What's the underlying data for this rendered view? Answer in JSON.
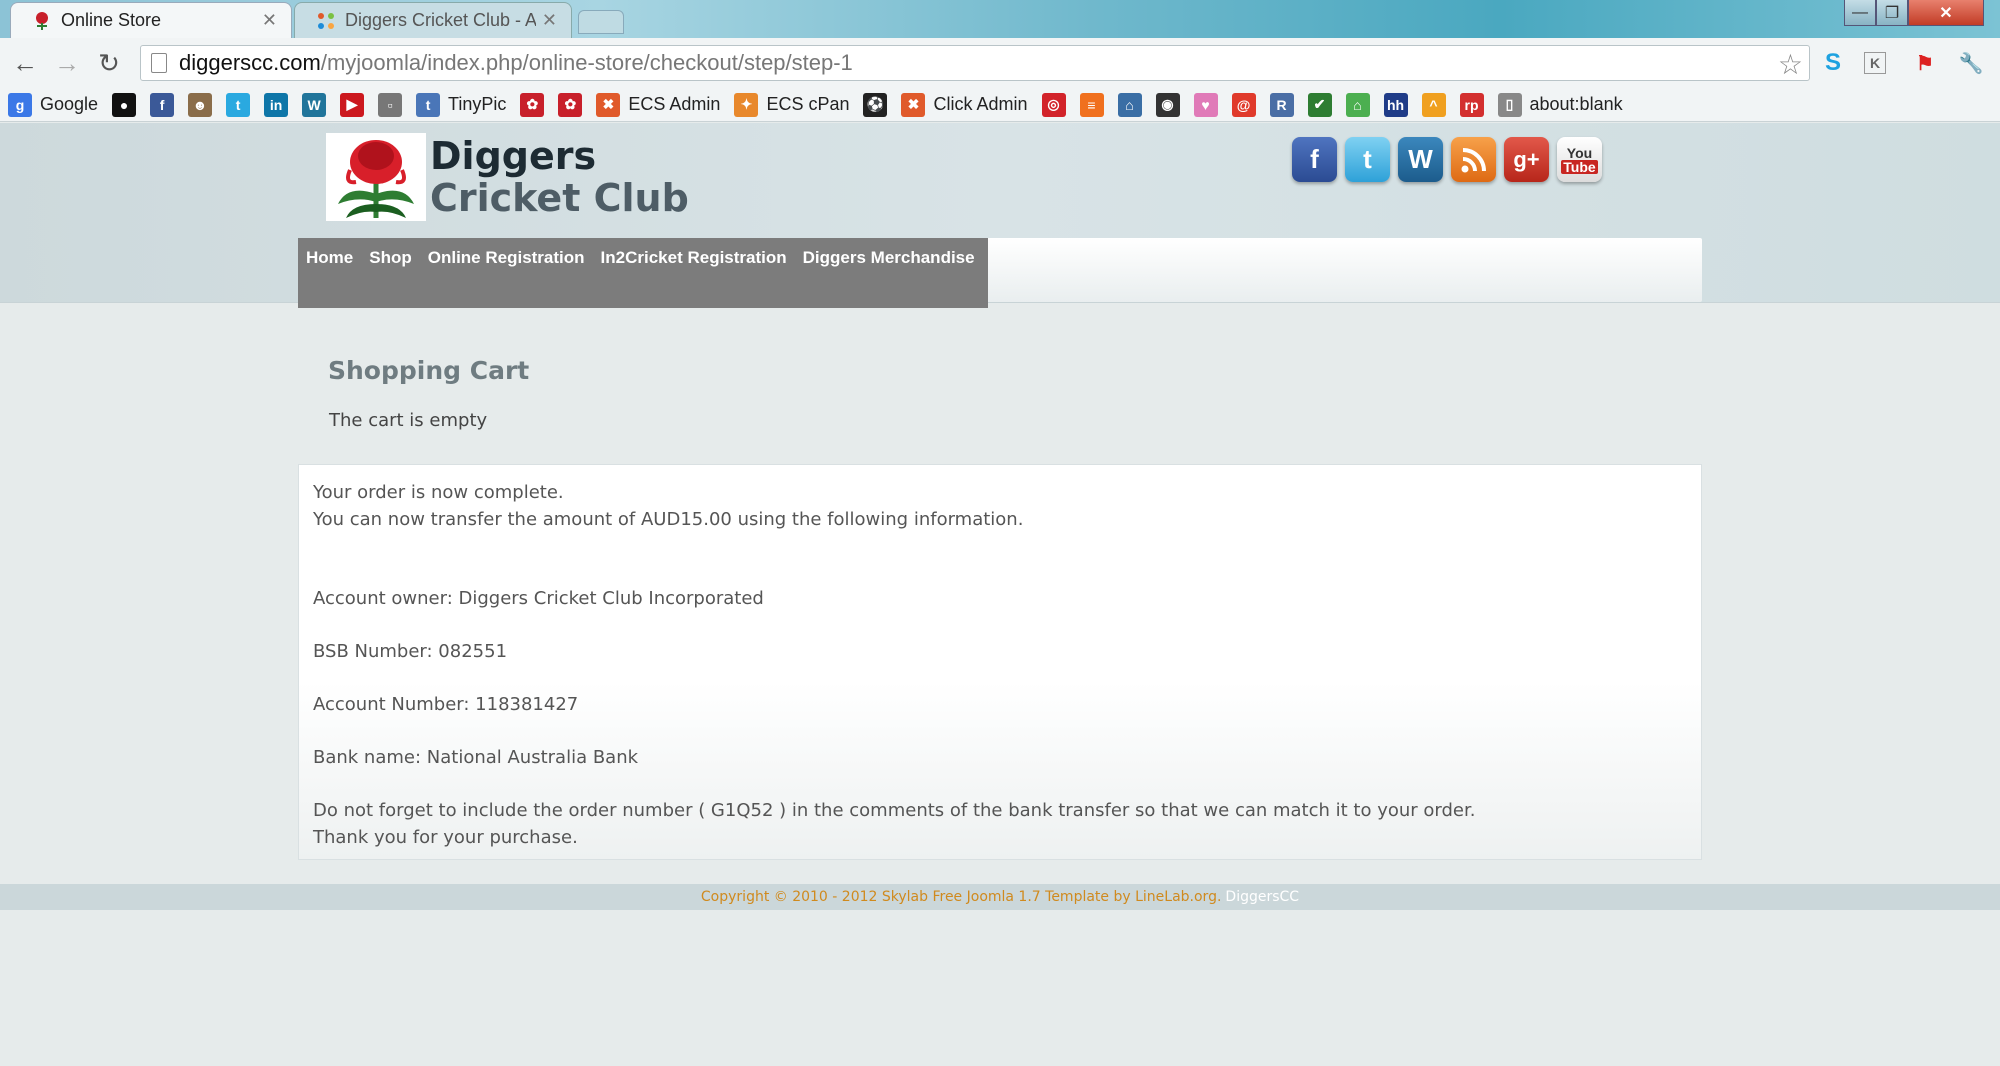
{
  "browser": {
    "tabs": [
      {
        "title": "Online Store",
        "active": true
      },
      {
        "title": "Diggers Cricket Club - Adm",
        "active": false
      }
    ],
    "url_host": "diggerscc.com",
    "url_path": "/myjoomla/index.php/online-store/checkout/step/step-1",
    "bookmarks": [
      {
        "label": "Google",
        "icon": "google-icon",
        "color": "#3b78e7"
      },
      {
        "label": "",
        "icon": "circle-icon",
        "color": "#111111"
      },
      {
        "label": "",
        "icon": "facebook-icon",
        "color": "#3b5998"
      },
      {
        "label": "",
        "icon": "owl-icon",
        "color": "#8a6d4a"
      },
      {
        "label": "",
        "icon": "twitter-icon",
        "color": "#2aa9e0"
      },
      {
        "label": "",
        "icon": "linkedin-icon",
        "color": "#0e76a8"
      },
      {
        "label": "",
        "icon": "wordpress-icon",
        "color": "#21759b"
      },
      {
        "label": "",
        "icon": "youtube-icon",
        "color": "#cc181e"
      },
      {
        "label": "",
        "icon": "square-icon",
        "color": "#777777"
      },
      {
        "label": "TinyPic",
        "icon": "tinypic-icon",
        "color": "#4a76b8"
      },
      {
        "label": "",
        "icon": "waratah-icon",
        "color": "#c8202b"
      },
      {
        "label": "",
        "icon": "waratah-icon",
        "color": "#c8202b"
      },
      {
        "label": "ECS Admin",
        "icon": "joomla-icon",
        "color": "#e05a2b"
      },
      {
        "label": "ECS cPan",
        "icon": "cpanel-icon",
        "color": "#e8882c"
      },
      {
        "label": "",
        "icon": "soccer-ball-icon",
        "color": "#222222"
      },
      {
        "label": "Click Admin",
        "icon": "joomla-icon",
        "color": "#e05a2b"
      },
      {
        "label": "",
        "icon": "lifebuoy-icon",
        "color": "#d2232a"
      },
      {
        "label": "",
        "icon": "stripes-icon",
        "color": "#f0701e"
      },
      {
        "label": "",
        "icon": "home-icon",
        "color": "#3a6ea5"
      },
      {
        "label": "",
        "icon": "webcam-icon",
        "color": "#333333"
      },
      {
        "label": "",
        "icon": "heart-icon",
        "color": "#e07ab8"
      },
      {
        "label": "",
        "icon": "swirl-icon",
        "color": "#e03a2b"
      },
      {
        "label": "",
        "icon": "rel-icon",
        "color": "#4a6ea5"
      },
      {
        "label": "",
        "icon": "leaf-icon",
        "color": "#2e7d32"
      },
      {
        "label": "",
        "icon": "house-green-icon",
        "color": "#4caf50"
      },
      {
        "label": "",
        "icon": "hh-icon",
        "color": "#1f3c88"
      },
      {
        "label": "",
        "icon": "caret-icon",
        "color": "#f0a020"
      },
      {
        "label": "",
        "icon": "rp-icon",
        "color": "#d32f2f"
      },
      {
        "label": "about:blank",
        "icon": "page-icon",
        "color": "#888888"
      }
    ]
  },
  "site": {
    "logo_line1": "Diggers",
    "logo_line2": "Cricket Club",
    "social": [
      "facebook",
      "twitter",
      "wordpress",
      "rss",
      "google-plus",
      "youtube"
    ],
    "menu": [
      "Home",
      "Shop",
      "Online Registration",
      "In2Cricket Registration",
      "Diggers Merchandise"
    ]
  },
  "content": {
    "title": "Shopping Cart",
    "cart_status": "The cart is empty",
    "order": {
      "line1": "Your order is now complete.",
      "line2": "You can now transfer the amount of AUD15.00 using the following information.",
      "owner": "Account owner: Diggers Cricket Club Incorporated",
      "bsb": "BSB Number: 082551",
      "account": "Account Number: 118381427",
      "bank": "Bank name: National Australia Bank",
      "note": "Do not forget to include the order number ( G1Q52 ) in the comments of the bank transfer so that we can match it to your order.",
      "thanks": "Thank you for your purchase."
    }
  },
  "footer": {
    "copyright": "Copyright © 2010 - 2012 Skylab Free Joomla 1.7 Template by LineLab.org.",
    "site": "DiggersCC"
  },
  "colors": {
    "menu_bg": "#7c7c7c",
    "footer_text": "#d08a1e",
    "page_bg": "#e6ebeb"
  }
}
